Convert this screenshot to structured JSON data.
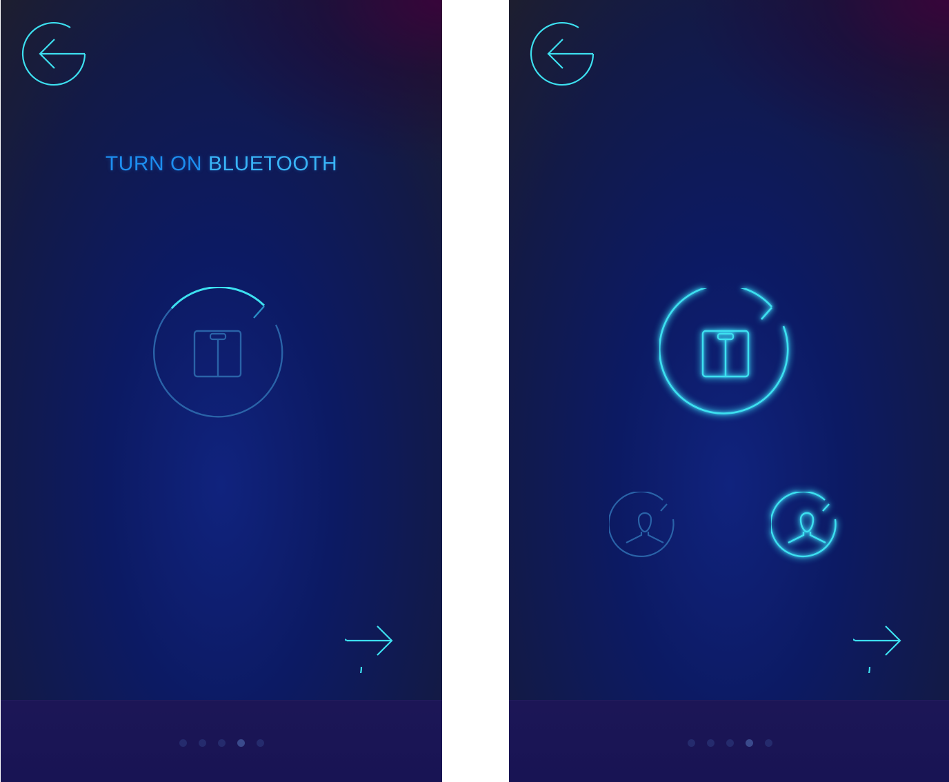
{
  "screens": [
    {
      "id": "bluetooth",
      "title_part1": "TURN ON ",
      "title_part2": "BLUETOOTH",
      "pagination": {
        "total": 5,
        "active_index": 3
      },
      "scale_state": "dim"
    },
    {
      "id": "profiles",
      "pagination": {
        "total": 5,
        "active_index": 3
      },
      "scale_state": "active",
      "profiles": [
        {
          "state": "dim",
          "icon": "user-icon"
        },
        {
          "state": "active",
          "icon": "user-icon"
        }
      ]
    }
  ],
  "colors": {
    "accent_cyan": "#3de0f0",
    "dim_blue": "#2a63a8",
    "title_blue": "#1d8ef0",
    "title_accent": "#39b4f7"
  },
  "icons": {
    "back": "arrow-left-icon",
    "next": "arrow-right-icon",
    "scale": "bathroom-scale-icon",
    "profile": "user-icon"
  }
}
